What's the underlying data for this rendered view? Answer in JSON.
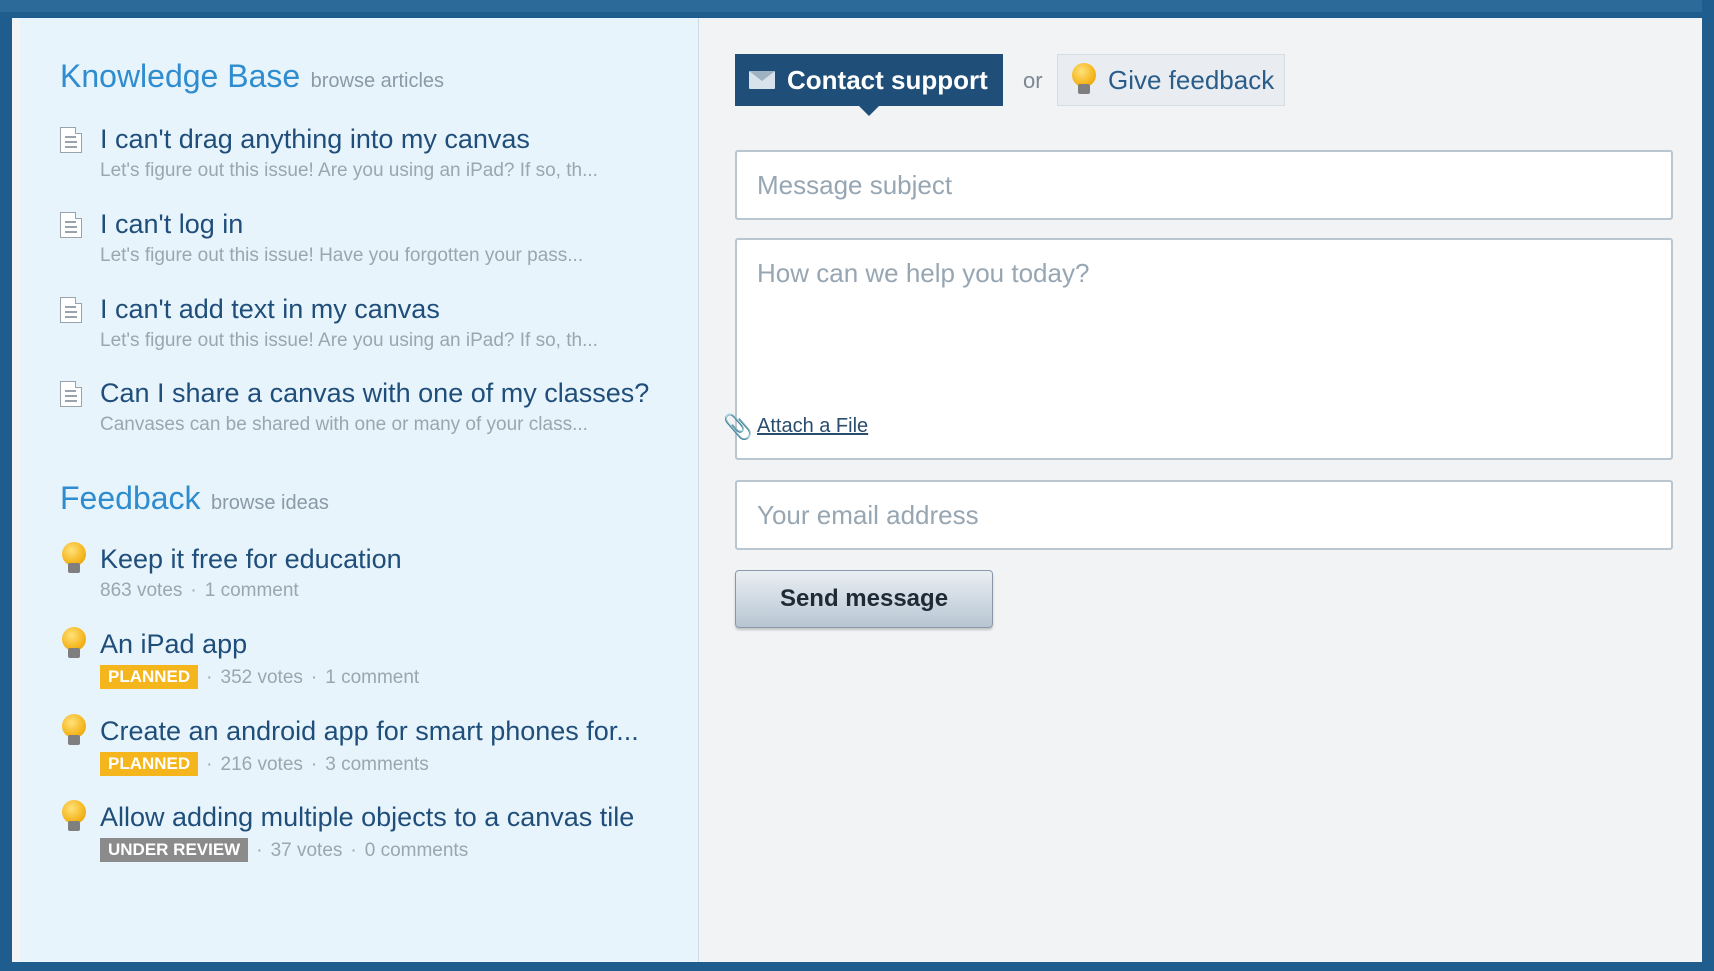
{
  "knowledge_base": {
    "title": "Knowledge Base",
    "browse_link": "browse articles",
    "articles": [
      {
        "title": "I can't drag anything into my canvas",
        "snippet": "Let's figure out this issue! Are you using an iPad? If so, th..."
      },
      {
        "title": "I can't log in",
        "snippet": "Let's figure out this issue! Have you forgotten your pass..."
      },
      {
        "title": "I can't add text in my canvas",
        "snippet": "Let's figure out this issue! Are you using an iPad? If so, th..."
      },
      {
        "title": "Can I share a canvas with one of my classes?",
        "snippet": "Canvases can be shared with one or many of your class..."
      }
    ]
  },
  "feedback": {
    "title": "Feedback",
    "browse_link": "browse ideas",
    "ideas": [
      {
        "title": "Keep it free for education",
        "status": "",
        "votes": "863 votes",
        "comments": "1 comment"
      },
      {
        "title": "An iPad app",
        "status": "PLANNED",
        "votes": "352 votes",
        "comments": "1 comment"
      },
      {
        "title": "Create an android app for smart phones for...",
        "status": "PLANNED",
        "votes": "216 votes",
        "comments": "3 comments"
      },
      {
        "title": "Allow adding multiple objects to a canvas tile",
        "status": "UNDER REVIEW",
        "votes": "37 votes",
        "comments": "0 comments"
      }
    ]
  },
  "contact": {
    "tab_contact_label": "Contact support",
    "or_label": "or",
    "tab_feedback_label": "Give feedback",
    "subject_placeholder": "Message subject",
    "body_placeholder": "How can we help you today?",
    "attach_label": "Attach a File",
    "email_placeholder": "Your email address",
    "send_label": "Send message"
  },
  "icons": {
    "article": "document-icon",
    "idea": "lightbulb-icon",
    "mail": "mail-icon",
    "attach": "paperclip-icon"
  },
  "colors": {
    "accent": "#2e8ccf",
    "link": "#1f4e7a",
    "contact_tab": "#1f4f78",
    "planned": "#f5b51d",
    "under_review": "#8b8b8b",
    "frame": "#1f5d8e"
  }
}
